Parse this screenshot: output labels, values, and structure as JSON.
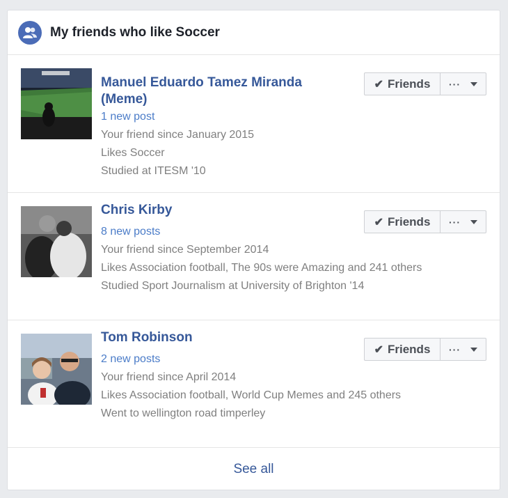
{
  "header": {
    "title": "My friends who like Soccer",
    "icon": "friends-icon"
  },
  "friends": [
    {
      "name_line1": "Manuel Eduardo Tamez Miranda",
      "name_line2": "(Meme)",
      "posts": "1 new post",
      "since": "Your friend since January 2015",
      "likes": "Likes Soccer",
      "education": "Studied at ITESM '10",
      "photo": "stadium-photo"
    },
    {
      "name_line1": "Chris Kirby",
      "posts": "8 new posts",
      "since": "Your friend since September 2014",
      "likes": "Likes Association football, The 90s were Amazing and 241 others",
      "education": "Studied Sport Journalism at University of Brighton '14",
      "photo": "couple-photo"
    },
    {
      "name_line1": "Tom Robinson",
      "posts": "2 new posts",
      "since": "Your friend since April 2014",
      "likes": "Likes Association football, World Cup Memes and 245 others",
      "education": "Went to wellington road timperley",
      "photo": "selfie-photo"
    }
  ],
  "buttons": {
    "friends_label": "Friends",
    "more_label": "···"
  },
  "footer": {
    "see_all": "See all"
  },
  "colors": {
    "link": "#365899",
    "posts": "#4b7cc8",
    "muted": "#7f7f7f"
  }
}
